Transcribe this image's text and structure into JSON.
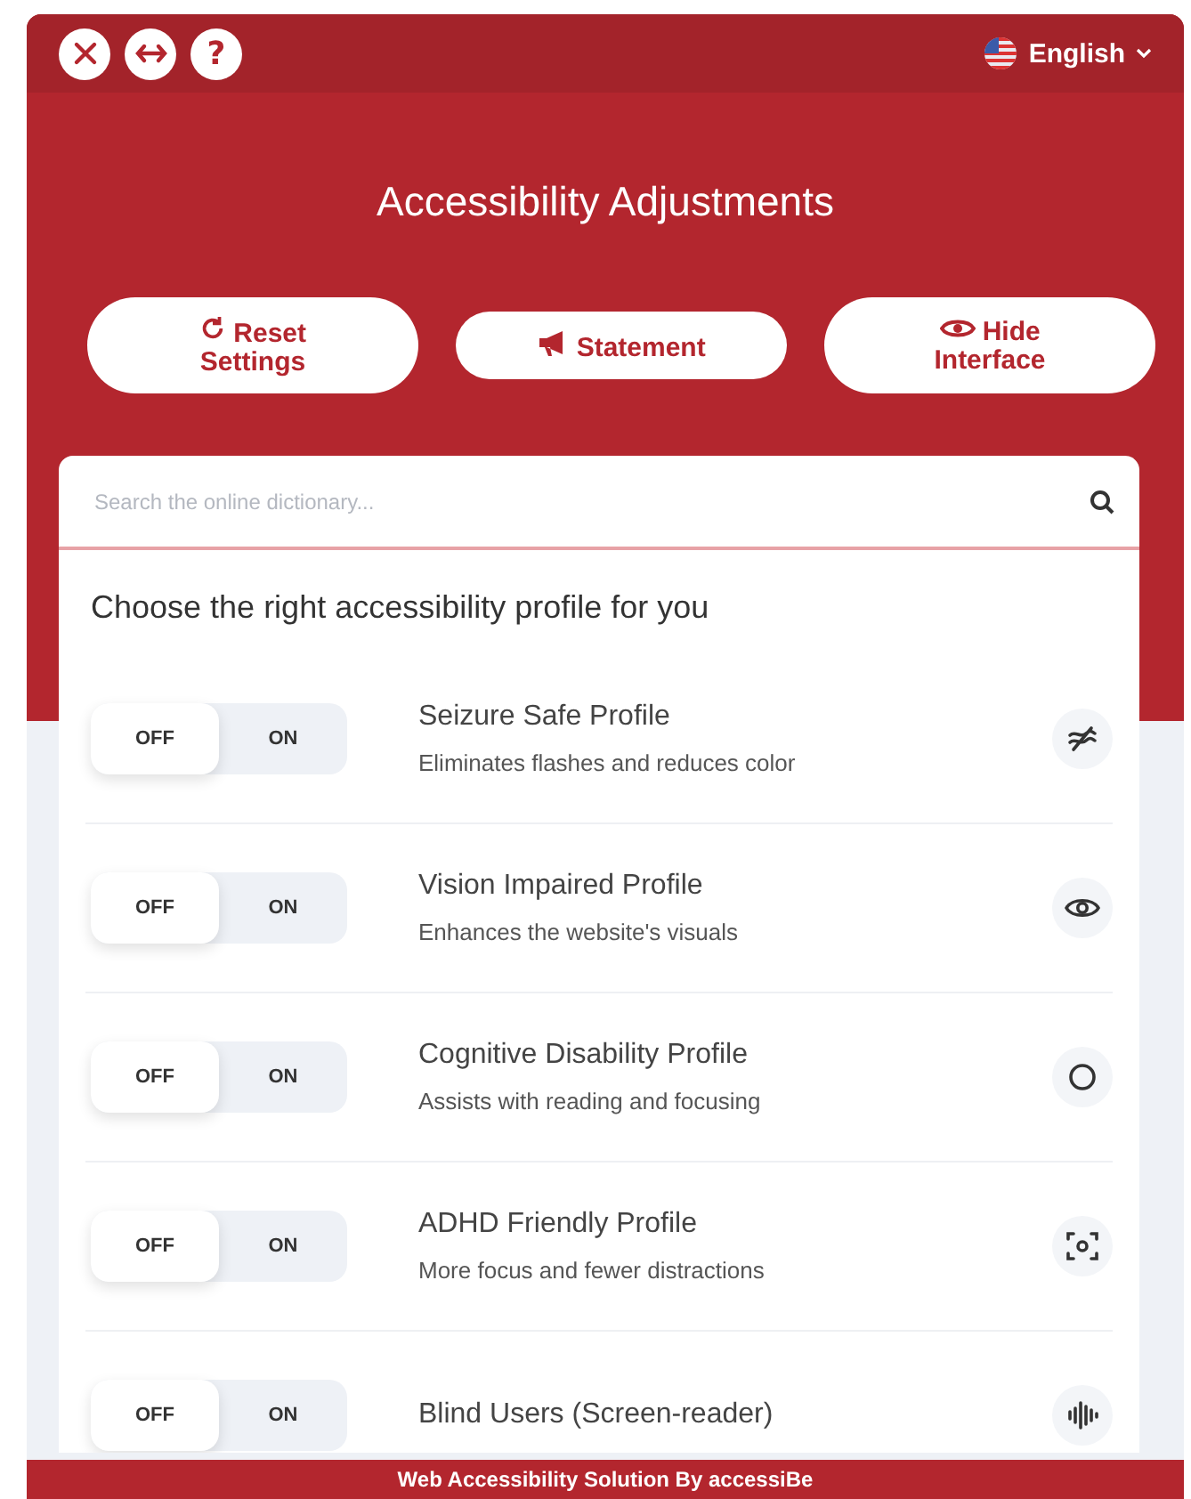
{
  "header": {
    "buttons": [
      {
        "kind": "close"
      },
      {
        "kind": "arrows"
      },
      {
        "kind": "help",
        "label": "?"
      }
    ],
    "language": "English"
  },
  "title": "Accessibility Adjustments",
  "actions": [
    {
      "kind": "reset",
      "label": "Reset Settings"
    },
    {
      "kind": "statement",
      "label": "Statement"
    },
    {
      "kind": "hide",
      "label": "Hide Interface"
    }
  ],
  "search": {
    "placeholder": "Search the online dictionary..."
  },
  "profiles_heading": "Choose the right accessibility profile for you",
  "profiles": [
    {
      "off_label": "OFF",
      "on_label": "ON",
      "on": false,
      "name": "Seizure Safe Profile",
      "description": "Eliminates flashes and reduces color",
      "kind": "seizure"
    },
    {
      "off_label": "OFF",
      "on_label": "ON",
      "on": false,
      "name": "Vision Impaired Profile",
      "description": "Enhances the website's visuals",
      "kind": "eye"
    },
    {
      "off_label": "OFF",
      "on_label": "ON",
      "on": false,
      "name": "Cognitive Disability Profile",
      "description": "Assists with reading and focusing",
      "kind": "circle"
    },
    {
      "off_label": "OFF",
      "on_label": "ON",
      "on": false,
      "name": "ADHD Friendly Profile",
      "description": "More focus and fewer distractions",
      "kind": "focus"
    },
    {
      "off_label": "OFF",
      "on_label": "ON",
      "on": false,
      "name": "Blind Users (Screen-reader)",
      "kind": "wave"
    }
  ],
  "footer": "Web Accessibility Solution By accessiBe"
}
